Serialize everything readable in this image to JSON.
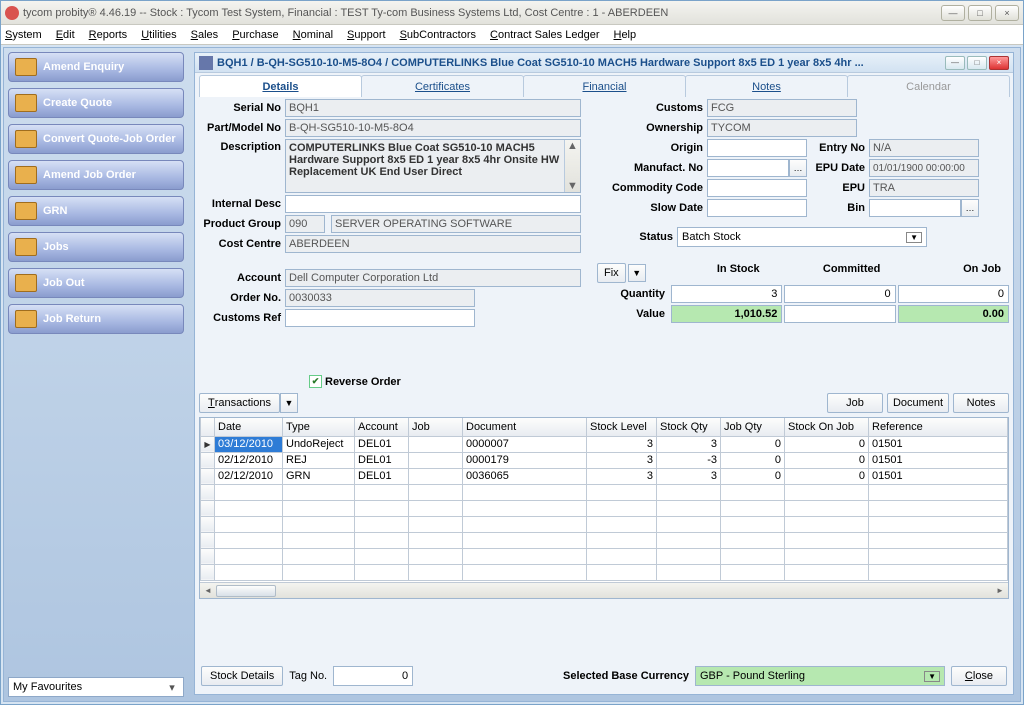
{
  "window": {
    "title": "tycom probity®  4.46.19 -- Stock : Tycom Test System, Financial : TEST Ty-com Business Systems Ltd, Cost Centre : 1 - ABERDEEN"
  },
  "menus": [
    "System",
    "Edit",
    "Reports",
    "Utilities",
    "Sales",
    "Purchase",
    "Nominal",
    "Support",
    "SubContractors",
    "Contract Sales Ledger",
    "Help"
  ],
  "shortcuts": [
    "Amend Enquiry",
    "Create Quote",
    "Convert Quote-Job Order",
    "Amend Job Order",
    "GRN",
    "Jobs",
    "Job Out",
    "Job Return"
  ],
  "favourites_label": "My Favourites",
  "inner": {
    "title": "BQH1 / B-QH-SG510-10-M5-8O4 / COMPUTERLINKS Blue Coat SG510-10 MACH5 Hardware Support 8x5 ED 1 year 8x5 4hr ...",
    "tabs": [
      "Details",
      "Certificates",
      "Financial",
      "Notes",
      "Calendar"
    ]
  },
  "left_form": {
    "labels": {
      "serial": "Serial No",
      "part": "Part/Model No",
      "desc": "Description",
      "internal": "Internal Desc",
      "pgroup": "Product Group",
      "ccentre": "Cost Centre",
      "account": "Account",
      "orderno": "Order No.",
      "custref": "Customs Ref"
    },
    "values": {
      "serial": "BQH1",
      "part": "B-QH-SG510-10-M5-8O4",
      "desc": "COMPUTERLINKS Blue Coat SG510-10 MACH5 Hardware Support 8x5 ED 1 year 8x5 4hr Onsite HW Replacement UK End User Direct",
      "internal": "",
      "pgroup_code": "090",
      "pgroup_name": "SERVER OPERATING SOFTWARE",
      "ccentre": "ABERDEEN",
      "account": "Dell Computer Corporation Ltd",
      "orderno": "0030033",
      "custref": ""
    }
  },
  "right_form": {
    "labels": {
      "customs": "Customs",
      "ownership": "Ownership",
      "origin": "Origin",
      "entryno": "Entry No",
      "manuf": "Manufact. No",
      "epudate": "EPU Date",
      "commodity": "Commodity Code",
      "epu": "EPU",
      "slow": "Slow Date",
      "bin": "Bin",
      "status": "Status"
    },
    "values": {
      "customs": "FCG",
      "ownership": "TYCOM",
      "origin": "",
      "entryno": "N/A",
      "manuf": "",
      "epudate": "01/01/1900 00:00:00",
      "commodity": "",
      "epu": "TRA",
      "slow": "",
      "bin": "",
      "status": "Batch Stock"
    }
  },
  "stock": {
    "fix": "Fix",
    "headers": {
      "instock": "In Stock",
      "committed": "Committed",
      "onjob": "On Job"
    },
    "rowlabels": {
      "qty": "Quantity",
      "val": "Value"
    },
    "qty": {
      "instock": "3",
      "committed": "0",
      "onjob": "0"
    },
    "val": {
      "instock": "1,010.52",
      "committed": "",
      "onjob": "0.00"
    }
  },
  "trans": {
    "reverse": "Reverse Order",
    "trans_btn": "Transactions",
    "buttons": {
      "job": "Job",
      "document": "Document",
      "notes": "Notes"
    },
    "cols": [
      "Date",
      "Type",
      "Account",
      "Job",
      "Document",
      "Stock Level",
      "Stock Qty",
      "Job Qty",
      "Stock On Job",
      "Reference"
    ],
    "rows": [
      {
        "date": "03/12/2010",
        "type": "UndoReject",
        "account": "DEL01",
        "job": "",
        "document": "0000007",
        "slevel": "3",
        "sqty": "3",
        "jqty": "0",
        "sonjob": "0",
        "ref": "01501"
      },
      {
        "date": "02/12/2010",
        "type": "REJ",
        "account": "DEL01",
        "job": "",
        "document": "0000179",
        "slevel": "3",
        "sqty": "-3",
        "jqty": "0",
        "sonjob": "0",
        "ref": "01501"
      },
      {
        "date": "02/12/2010",
        "type": "GRN",
        "account": "DEL01",
        "job": "",
        "document": "0036065",
        "slevel": "3",
        "sqty": "3",
        "jqty": "0",
        "sonjob": "0",
        "ref": "01501"
      }
    ]
  },
  "bottom": {
    "stock_details": "Stock Details",
    "tag_label": "Tag No.",
    "tag_value": "0",
    "curr_label": "Selected Base Currency",
    "curr_value": "GBP - Pound Sterling",
    "close": "Close"
  }
}
